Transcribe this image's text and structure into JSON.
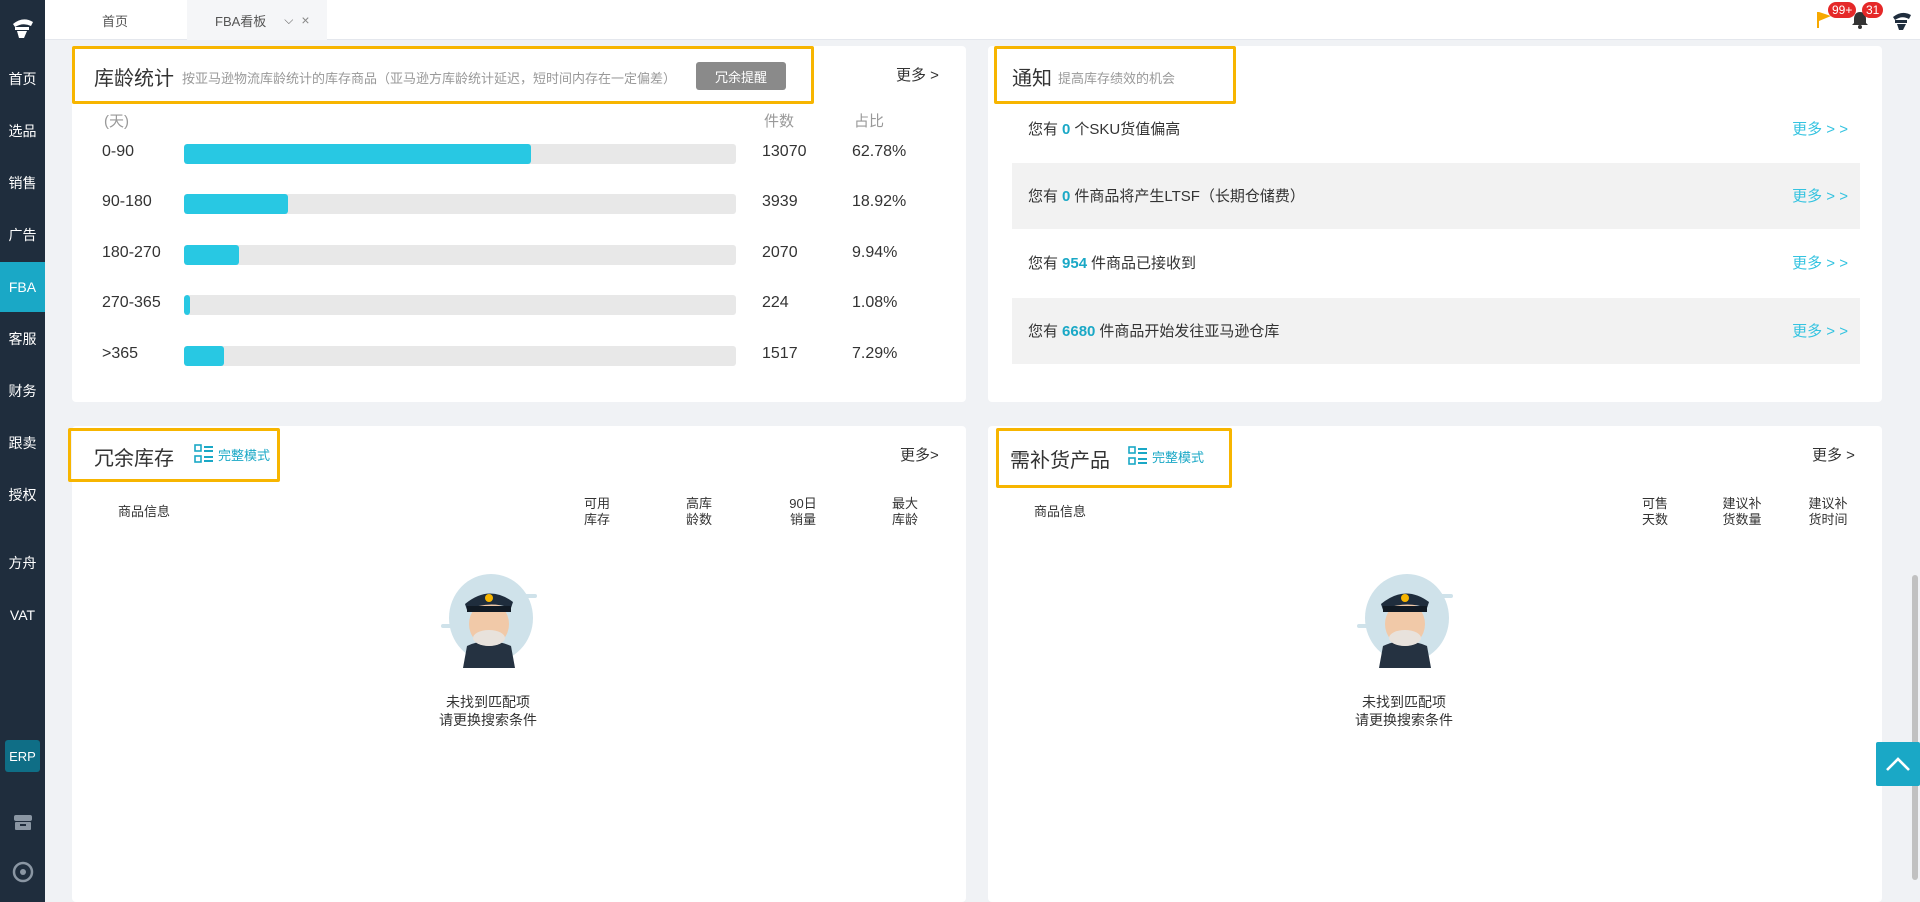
{
  "sidebar": {
    "logo_icon": "captain-hat-logo-icon",
    "items": [
      {
        "label": "首页"
      },
      {
        "label": "选品"
      },
      {
        "label": "销售"
      },
      {
        "label": "广告"
      },
      {
        "label": "FBA",
        "active": true
      },
      {
        "label": "客服"
      },
      {
        "label": "财务"
      },
      {
        "label": "跟卖"
      },
      {
        "label": "授权"
      },
      {
        "label": "方舟"
      },
      {
        "label": "VAT"
      }
    ],
    "erp_label": "ERP",
    "bottom_icons": [
      "store-icon",
      "support-icon"
    ],
    "accent_color": "#1aa8c6"
  },
  "tabs": {
    "home_label": "首页",
    "fba_label": "FBA看板"
  },
  "topbar": {
    "flag_badge": "99+",
    "bell_badge": "31"
  },
  "age_stats": {
    "title": "库龄统计",
    "subtitle": "按亚马逊物流库龄统计的库存商品（亚马逊方库龄统计延迟，短时间内存在一定偏差）",
    "button_label": "冗余提醒",
    "more_label": "更多 >",
    "col_days": "(天)",
    "col_count": "件数",
    "col_pct": "占比",
    "rows": [
      {
        "range": "0-90",
        "count": "13070",
        "pct": "62.78%",
        "fill": 0.628
      },
      {
        "range": "90-180",
        "count": "3939",
        "pct": "18.92%",
        "fill": 0.189
      },
      {
        "range": "180-270",
        "count": "2070",
        "pct": "9.94%",
        "fill": 0.099
      },
      {
        "range": "270-365",
        "count": "224",
        "pct": "1.08%",
        "fill": 0.011
      },
      {
        "range": ">365",
        "count": "1517",
        "pct": "7.29%",
        "fill": 0.073
      }
    ]
  },
  "notices": {
    "title": "通知",
    "subtitle": "提高库存绩效的机会",
    "items": [
      {
        "prefix": "您有",
        "num": "0",
        "suffix": "个SKU货值偏高",
        "more": "更多 > >"
      },
      {
        "prefix": "您有",
        "num": "0",
        "suffix": "件商品将产生LTSF（长期仓储费）",
        "more": "更多 > >"
      },
      {
        "prefix": "您有",
        "num": "954",
        "suffix": "件商品已接收到",
        "more": "更多 > >"
      },
      {
        "prefix": "您有",
        "num": "6680",
        "suffix": "件商品开始发往亚马逊仓库",
        "more": "更多 > >"
      }
    ]
  },
  "excess": {
    "title": "冗余库存",
    "mode_label": "完整模式",
    "more_label": "更多>",
    "headers": {
      "product": "商品信息",
      "avail_1": "可用",
      "avail_2": "库存",
      "high_1": "高库",
      "high_2": "龄数",
      "sales_1": "90日",
      "sales_2": "销量",
      "max_1": "最大",
      "max_2": "库龄"
    },
    "empty_1": "未找到匹配项",
    "empty_2": "请更换搜索条件"
  },
  "restock": {
    "title": "需补货产品",
    "mode_label": "完整模式",
    "more_label": "更多 >",
    "headers": {
      "product": "商品信息",
      "days_1": "可售",
      "days_2": "天数",
      "qty_1": "建议补",
      "qty_2": "货数量",
      "time_1": "建议补",
      "time_2": "货时间"
    },
    "empty_1": "未找到匹配项",
    "empty_2": "请更换搜索条件"
  }
}
